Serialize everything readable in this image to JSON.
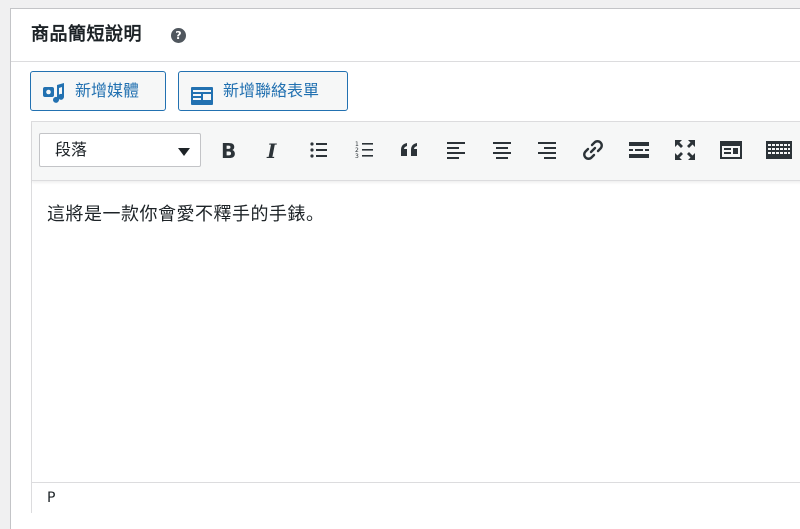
{
  "panel": {
    "title": "商品簡短說明",
    "help_icon": "question-circle-icon"
  },
  "media_buttons": {
    "add_media_label": "新增媒體",
    "add_form_label": "新增聯絡表單"
  },
  "toolbar": {
    "format_select_value": "段落",
    "buttons": [
      "bold",
      "italic",
      "bullet-list",
      "numbered-list",
      "blockquote",
      "align-left",
      "align-center",
      "align-right",
      "link",
      "read-more",
      "fullscreen",
      "toolbar-toggle",
      "keyboard"
    ]
  },
  "editor": {
    "content": "這將是一款你會愛不釋手的手錶。"
  },
  "statusbar": {
    "path": "P"
  },
  "colors": {
    "accent": "#2271b1",
    "text": "#1d2327",
    "toolbar_bg": "#f6f7f7",
    "border": "#dcdcde"
  }
}
